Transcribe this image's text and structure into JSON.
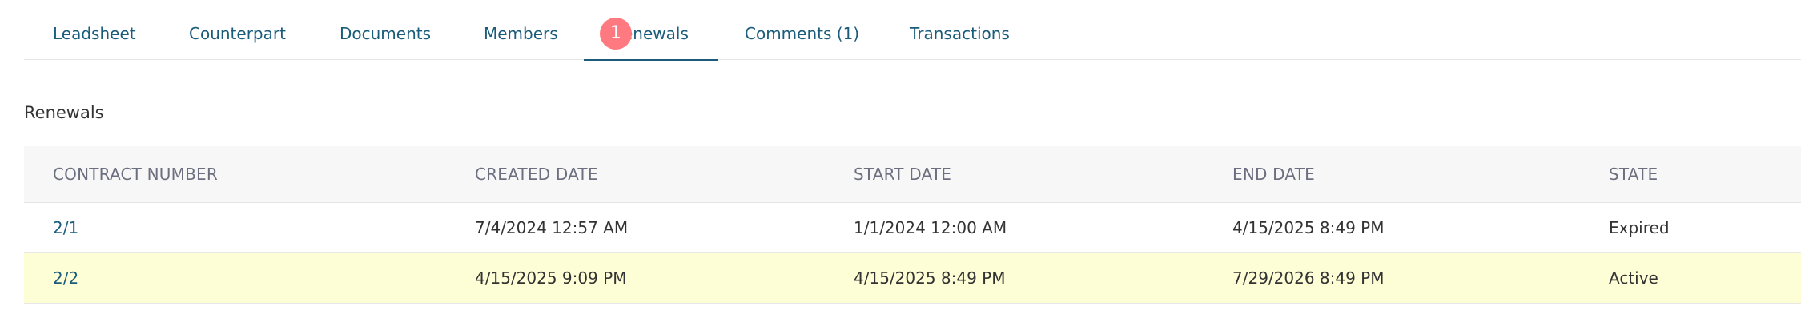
{
  "tabs": [
    {
      "label": "Leadsheet"
    },
    {
      "label": "Counterpart"
    },
    {
      "label": "Documents"
    },
    {
      "label": "Members"
    },
    {
      "label": "Renewals"
    },
    {
      "label": "Comments (1)"
    },
    {
      "label": "Transactions"
    }
  ],
  "active_tab": "Renewals",
  "badge": {
    "value": "1",
    "color": "#ff7a80"
  },
  "section": {
    "title": "Renewals"
  },
  "table": {
    "headers": [
      "CONTRACT NUMBER",
      "CREATED DATE",
      "START DATE",
      "END DATE",
      "STATE"
    ],
    "rows": [
      {
        "contract_number": "2/1",
        "created_date": "7/4/2024 12:57 AM",
        "start_date": "1/1/2024 12:00 AM",
        "end_date": "4/15/2025 8:49 PM",
        "state": "Expired"
      },
      {
        "contract_number": "2/2",
        "created_date": "4/15/2025 9:09 PM",
        "start_date": "4/15/2025 8:49 PM",
        "end_date": "7/29/2026 8:49 PM",
        "state": "Active"
      }
    ]
  },
  "colors": {
    "link": "#1a5c7a",
    "highlight_row": "#fdfdd6",
    "header_bg": "#f7f7f7"
  }
}
